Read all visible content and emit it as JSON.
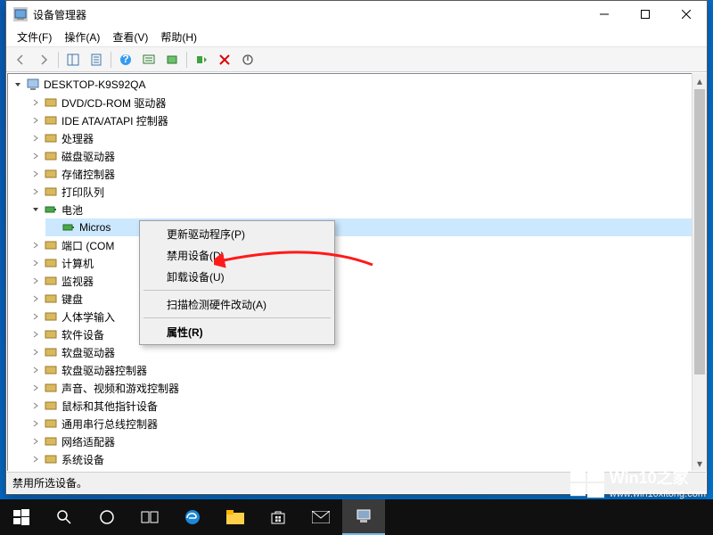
{
  "window": {
    "title": "设备管理器",
    "menu": {
      "file": "文件(F)",
      "action": "操作(A)",
      "view": "查看(V)",
      "help": "帮助(H)"
    },
    "status": "禁用所选设备。"
  },
  "tree": {
    "root": "DESKTOP-K9S92QA",
    "items": [
      {
        "label": "DVD/CD-ROM 驱动器"
      },
      {
        "label": "IDE ATA/ATAPI 控制器"
      },
      {
        "label": "处理器"
      },
      {
        "label": "磁盘驱动器"
      },
      {
        "label": "存储控制器"
      },
      {
        "label": "打印队列"
      },
      {
        "label": "电池",
        "expanded": true,
        "child": {
          "label": "Micros",
          "selected": true
        }
      },
      {
        "label": "端口 (COM"
      },
      {
        "label": "计算机"
      },
      {
        "label": "监视器"
      },
      {
        "label": "键盘"
      },
      {
        "label": "人体学输入"
      },
      {
        "label": "软件设备"
      },
      {
        "label": "软盘驱动器"
      },
      {
        "label": "软盘驱动器控制器"
      },
      {
        "label": "声音、视频和游戏控制器"
      },
      {
        "label": "鼠标和其他指针设备"
      },
      {
        "label": "通用串行总线控制器"
      },
      {
        "label": "网络适配器"
      },
      {
        "label": "系统设备"
      }
    ]
  },
  "context_menu": {
    "update_driver": "更新驱动程序(P)",
    "disable_device": "禁用设备(D)",
    "uninstall_device": "卸载设备(U)",
    "scan_hardware": "扫描检测硬件改动(A)",
    "properties": "属性(R)"
  },
  "watermark": {
    "title": "Win10之家",
    "url": "www.win10xitong.com"
  },
  "colors": {
    "accent": "#0078d7",
    "selection": "#cce8ff",
    "menu_hover": "#90c8f6",
    "arrow": "#ff1a1a"
  }
}
